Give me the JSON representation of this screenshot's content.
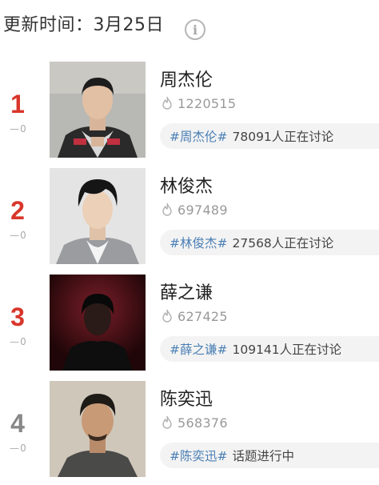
{
  "header": {
    "update_time": "更新时间：3月25日",
    "info_icon": "info-icon"
  },
  "ranks": [
    {
      "rank": "1",
      "change": "—0",
      "name": "周杰伦",
      "heat": "1220515",
      "topic_tag": "#周杰伦#",
      "topic_desc": "78091人正在讨论",
      "rank_color": "#d9362b"
    },
    {
      "rank": "2",
      "change": "—0",
      "name": "林俊杰",
      "heat": "697489",
      "topic_tag": "#林俊杰#",
      "topic_desc": "27568人正在讨论",
      "rank_color": "#d9362b"
    },
    {
      "rank": "3",
      "change": "—0",
      "name": "薛之谦",
      "heat": "627425",
      "topic_tag": "#薛之谦#",
      "topic_desc": "109141人正在讨论",
      "rank_color": "#d9362b"
    },
    {
      "rank": "4",
      "change": "—0",
      "name": "陈奕迅",
      "heat": "568376",
      "topic_tag": "#陈奕迅#",
      "topic_desc": "话题进行中",
      "rank_color": "#888888"
    }
  ],
  "colors": {
    "top_rank": "#d9362b",
    "other_rank": "#888888",
    "topic_tag": "#4a7fb5",
    "topic_bg": "#f3f3f3"
  }
}
